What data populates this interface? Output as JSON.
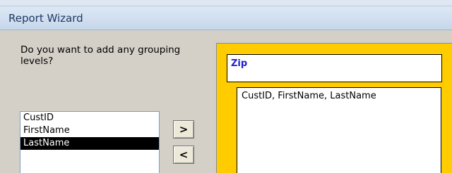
{
  "window": {
    "title": "Report Wizard"
  },
  "prompt": {
    "text": "Do you want to add any grouping levels?"
  },
  "field_list": {
    "items": [
      "CustID",
      "FirstName",
      "LastName"
    ],
    "selected": "LastName"
  },
  "buttons": {
    "add_label": ">",
    "remove_label": "<"
  },
  "preview": {
    "group_label": "Zip",
    "detail_fields": "CustID, FirstName, LastName",
    "accent_color": "#ffcc00",
    "group_label_color": "#1f1fd1"
  }
}
